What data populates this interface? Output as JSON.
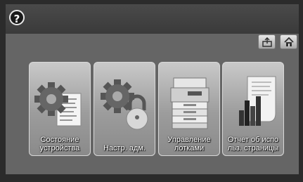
{
  "header": {
    "help_symbol": "?",
    "help_icon": "question-mark-icon",
    "export_icon": "export-icon",
    "home_icon": "home-icon"
  },
  "tiles": [
    {
      "label": "Состояние устройства",
      "icon": "gear-document-icon"
    },
    {
      "label": "Настр. адм.",
      "icon": "gear-lock-icon"
    },
    {
      "label": "Управление лотками",
      "icon": "printer-trays-icon"
    },
    {
      "label": "Отчет об испо льз. страницы",
      "icon": "usage-report-chart-icon"
    }
  ],
  "colors": {
    "background": "#2b2b2b",
    "panel": "#656565",
    "tile": "#b0b0b0"
  }
}
